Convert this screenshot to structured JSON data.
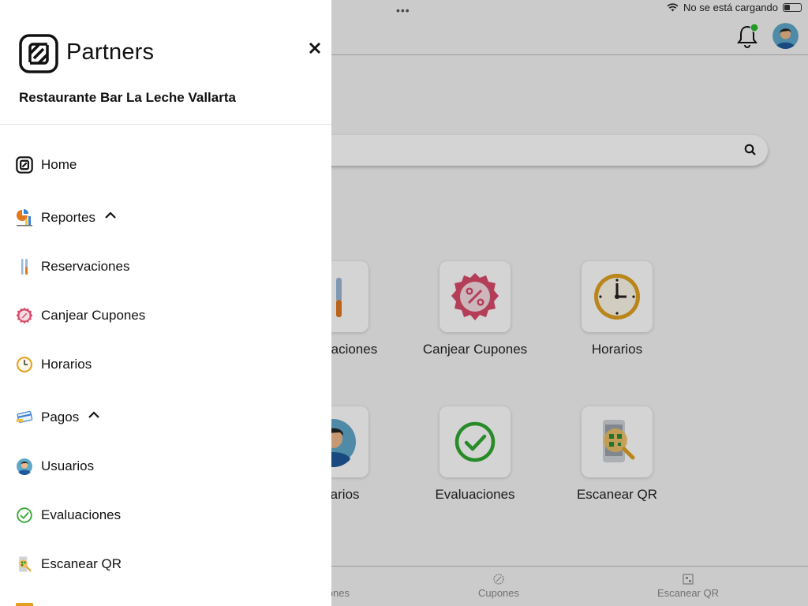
{
  "status": {
    "battery_text": "No se está cargando"
  },
  "main": {
    "tiles": [
      {
        "label": "Reservaciones",
        "icon": "utensils-icon"
      },
      {
        "label": "Canjear Cupones",
        "icon": "coupon-icon"
      },
      {
        "label": "Horarios",
        "icon": "clock-icon"
      },
      {
        "label": "Usuarios",
        "icon": "user-icon"
      },
      {
        "label": "Evaluaciones",
        "icon": "check-circle-icon"
      },
      {
        "label": "Escanear QR",
        "icon": "qr-scan-icon"
      }
    ]
  },
  "tabbar": {
    "tabs": [
      {
        "label": "Reservaciones",
        "icon": "utensils-icon"
      },
      {
        "label": "Cupones",
        "icon": "coupon-icon"
      },
      {
        "label": "Escanear QR",
        "icon": "qr-scan-icon"
      }
    ]
  },
  "drawer": {
    "brand": "Partners",
    "restaurant": "Restaurante Bar La Leche Vallarta",
    "items": [
      {
        "label": "Home",
        "icon": "partners-logo-icon"
      },
      {
        "label": "Reportes",
        "icon": "reports-icon",
        "expanded": true
      },
      {
        "label": "Reservaciones",
        "icon": "utensils-icon"
      },
      {
        "label": "Canjear Cupones",
        "icon": "coupon-icon"
      },
      {
        "label": "Horarios",
        "icon": "clock-icon"
      },
      {
        "label": "Pagos",
        "icon": "payment-card-icon",
        "expanded": true
      },
      {
        "label": "Usuarios",
        "icon": "user-icon"
      },
      {
        "label": "Evaluaciones",
        "icon": "check-circle-icon"
      },
      {
        "label": "Escanear QR",
        "icon": "qr-scan-icon"
      }
    ]
  },
  "colors": {
    "accent_green": "#2fa82f",
    "coupon_red": "#d94b6a",
    "clock_gold": "#e0a020",
    "notification_dot": "#2db82d"
  }
}
